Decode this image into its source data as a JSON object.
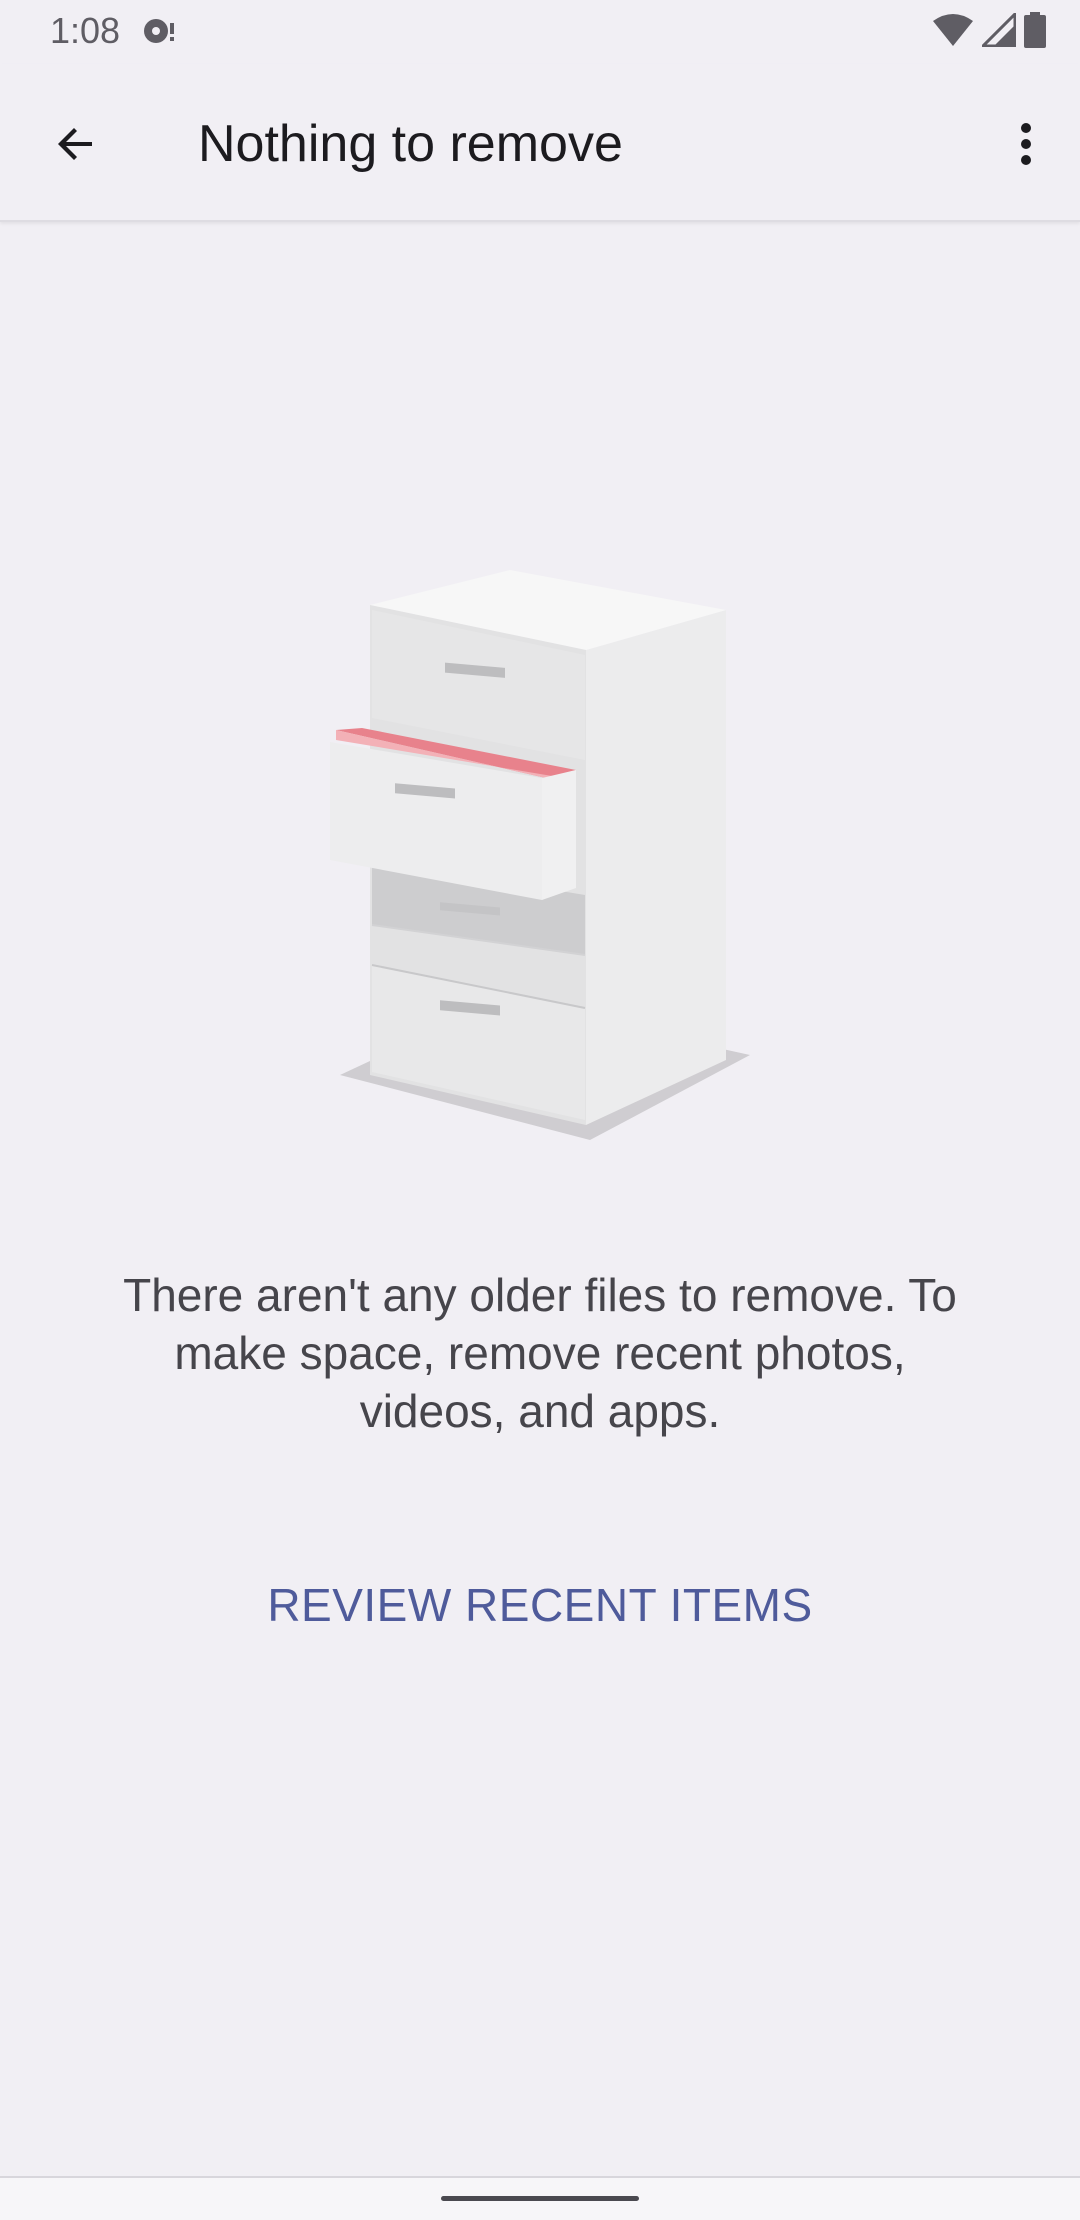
{
  "status_bar": {
    "time": "1:08",
    "notification_icon": "assistant-bubble-icon",
    "icons": [
      "wifi-icon",
      "cell-signal-icon",
      "battery-icon"
    ]
  },
  "app_bar": {
    "title": "Nothing to remove",
    "back_icon": "arrow-back-icon",
    "more_icon": "more-vert-icon"
  },
  "empty_state": {
    "illustration": "filing-cabinet-illustration",
    "message": "There aren't any older files to remove. To make space, remove recent photos, videos, and apps.",
    "action_label": "REVIEW RECENT ITEMS"
  },
  "colors": {
    "background": "#f1eff4",
    "accent": "#4f5b9b",
    "text_primary": "#1c1b1f",
    "text_secondary": "#46454b",
    "drawer_highlight": "#e8828c"
  }
}
